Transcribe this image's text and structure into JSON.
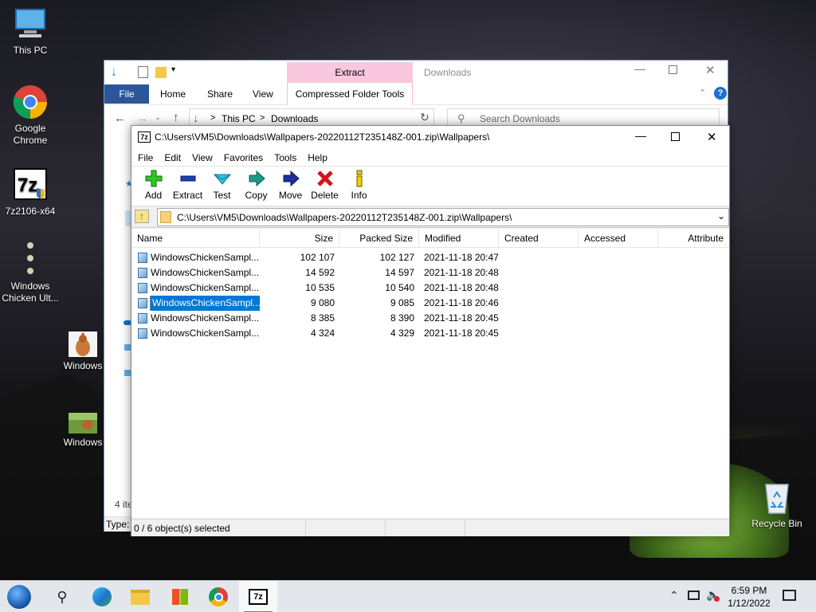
{
  "desktop": {
    "icons": [
      {
        "label": "This PC"
      },
      {
        "label": "Google Chrome"
      },
      {
        "label": "7z2106-x64"
      },
      {
        "label": "Windows Chicken Ult..."
      },
      {
        "label": "Windows"
      },
      {
        "label": "Windows"
      },
      {
        "label": "Recycle Bin"
      }
    ]
  },
  "explorer": {
    "title": "Downloads",
    "ribbon_context_group": "Extract",
    "tabs": [
      "File",
      "Home",
      "Share",
      "View",
      "Compressed Folder Tools"
    ],
    "breadcrumb": [
      "This PC",
      "Downloads"
    ],
    "search_placeholder": "Search Downloads",
    "items_count": "4 ite",
    "status_type": "Type:"
  },
  "zip": {
    "title": "C:\\Users\\VM5\\Downloads\\Wallpapers-20220112T235148Z-001.zip\\Wallpapers\\",
    "menu": [
      "File",
      "Edit",
      "View",
      "Favorites",
      "Tools",
      "Help"
    ],
    "toolbar": [
      {
        "label": "Add",
        "icon": "add-icon"
      },
      {
        "label": "Extract",
        "icon": "extract-icon"
      },
      {
        "label": "Test",
        "icon": "test-icon"
      },
      {
        "label": "Copy",
        "icon": "copy-icon"
      },
      {
        "label": "Move",
        "icon": "move-icon"
      },
      {
        "label": "Delete",
        "icon": "delete-icon"
      },
      {
        "label": "Info",
        "icon": "info-icon"
      }
    ],
    "address": "C:\\Users\\VM5\\Downloads\\Wallpapers-20220112T235148Z-001.zip\\Wallpapers\\",
    "columns": [
      "Name",
      "Size",
      "Packed Size",
      "Modified",
      "Created",
      "Accessed",
      "Attribute"
    ],
    "files": [
      {
        "name": "WindowsChickenSampl...",
        "size": "102 107",
        "packed": "102 127",
        "modified": "2021-11-18 20:47"
      },
      {
        "name": "WindowsChickenSampl...",
        "size": "14 592",
        "packed": "14 597",
        "modified": "2021-11-18 20:48"
      },
      {
        "name": "WindowsChickenSampl...",
        "size": "10 535",
        "packed": "10 540",
        "modified": "2021-11-18 20:48"
      },
      {
        "name": "WindowsChickenSampl...",
        "size": "9 080",
        "packed": "9 085",
        "modified": "2021-11-18 20:46"
      },
      {
        "name": "WindowsChickenSampl...",
        "size": "8 385",
        "packed": "8 390",
        "modified": "2021-11-18 20:45"
      },
      {
        "name": "WindowsChickenSampl...",
        "size": "4 324",
        "packed": "4 329",
        "modified": "2021-11-18 20:45"
      }
    ],
    "selected_index": 3,
    "status": "0 / 6 object(s) selected"
  },
  "taskbar": {
    "time": "6:59 PM",
    "date": "1/12/2022",
    "apps": [
      "start-icon",
      "search-icon",
      "edge-icon",
      "file-explorer-icon",
      "store-icon",
      "chrome-icon",
      "7zip-icon"
    ]
  },
  "colors": {
    "selection": "#0078d7",
    "ribbon_context": "#f9c8de",
    "file_tab": "#2b579a"
  }
}
